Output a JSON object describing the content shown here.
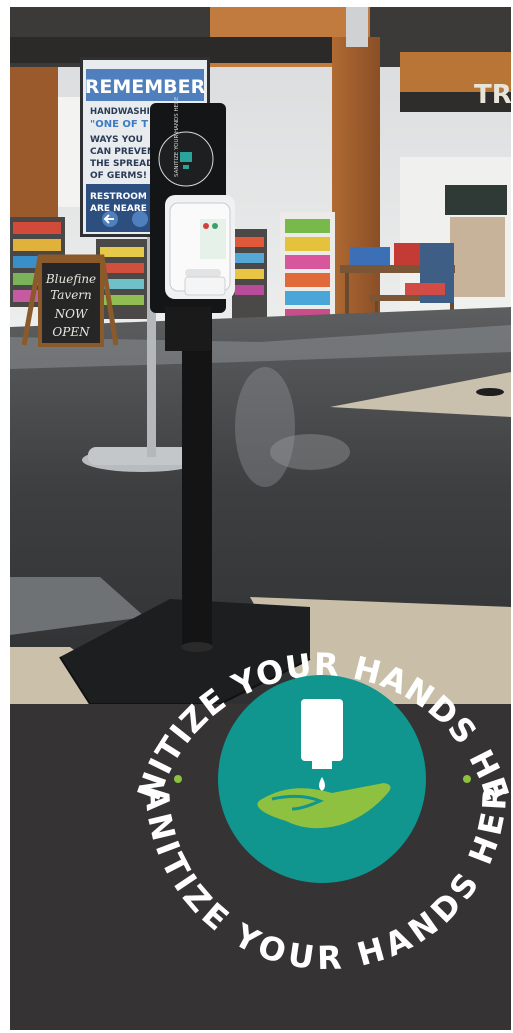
{
  "poster": {
    "heading": "REMEMBER",
    "lines": [
      "HANDWASHING",
      "\"ONE OF T",
      "WAYS YOU",
      "CAN PREVENT",
      "THE SPREAD",
      "OF GERMS!",
      "RESTROOM",
      "ARE NEARE"
    ]
  },
  "dispenser_panel": {
    "curve_text": "SANITIZE YOUR HANDS HERE"
  },
  "chalkboard": {
    "lines": [
      "Bluefine",
      "Tavern",
      "NOW",
      "OPEN"
    ]
  },
  "storefront": {
    "sign": "TRA"
  },
  "badge": {
    "top_text": "SANITIZE YOUR HANDS HERE",
    "bottom_text": "SANITIZE YOUR HANDS HERE",
    "circle_color": "#10958f",
    "hand_color": "#8dc13f",
    "icon": "sanitizer-hand-icon"
  },
  "colors": {
    "bottom_panel": "#353334",
    "text": "#ffffff"
  }
}
